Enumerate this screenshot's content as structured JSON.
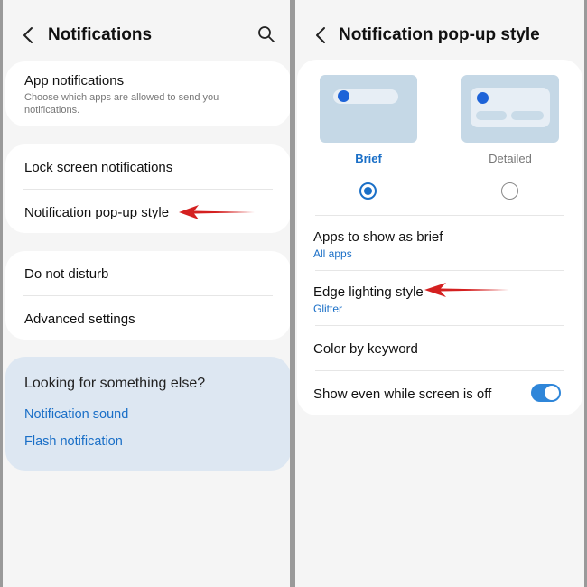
{
  "left": {
    "title": "Notifications",
    "app_notifications": {
      "label": "App notifications",
      "description": "Choose which apps are allowed to send you notifications."
    },
    "lock_screen": "Lock screen notifications",
    "popup_style": "Notification pop-up style",
    "do_not_disturb": "Do not disturb",
    "advanced": "Advanced settings",
    "help": {
      "question": "Looking for something else?",
      "link1": "Notification sound",
      "link2": "Flash notification"
    }
  },
  "right": {
    "title": "Notification pop-up style",
    "styles": [
      {
        "label": "Brief",
        "selected": true
      },
      {
        "label": "Detailed",
        "selected": false
      }
    ],
    "apps_brief": {
      "label": "Apps to show as brief",
      "value": "All apps"
    },
    "edge_lighting": {
      "label": "Edge lighting style",
      "value": "Glitter"
    },
    "color_keyword": "Color by keyword",
    "show_screen_off": {
      "label": "Show even while screen is off",
      "enabled": true
    }
  },
  "colors": {
    "accent": "#1a6fc7",
    "arrow": "#d42020",
    "help_bg": "#dde7f2",
    "preview_bg": "#c5d8e6"
  },
  "icons": [
    "back-arrow-icon",
    "search-icon",
    "red-arrow-icon"
  ]
}
